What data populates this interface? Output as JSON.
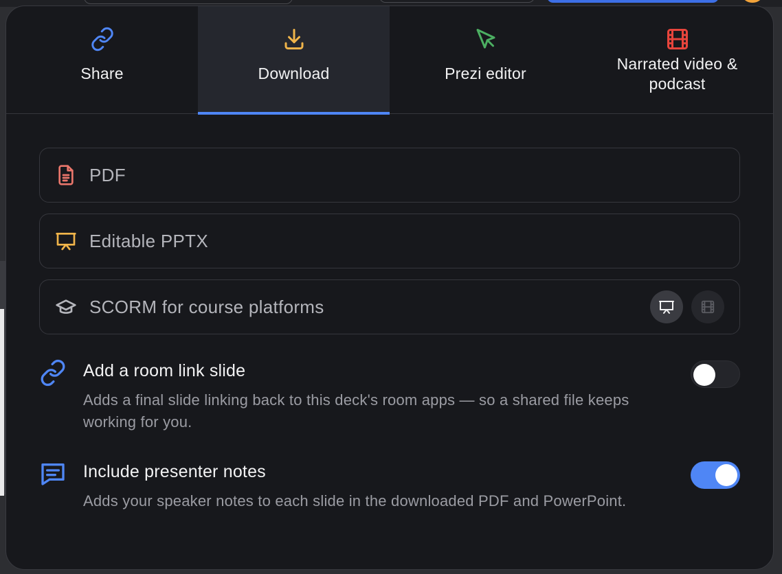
{
  "tabs": [
    {
      "label": "Share",
      "icon": "link-icon",
      "color": "#4f86f5",
      "active": false
    },
    {
      "label": "Download",
      "icon": "download-icon",
      "color": "#f0b44a",
      "active": true
    },
    {
      "label": "Prezi editor",
      "icon": "cursor-arrow-icon",
      "color": "#4caf62",
      "active": false
    },
    {
      "label": "Narrated video & podcast",
      "icon": "film-icon",
      "color": "#e8453c",
      "active": false
    }
  ],
  "download_options": [
    {
      "label": "PDF",
      "icon": "document-icon",
      "color": "#e9766b"
    },
    {
      "label": "Editable PPTX",
      "icon": "presentation-board-icon",
      "color": "#f0b44a"
    },
    {
      "label": "SCORM for course platforms",
      "icon": "graduation-cap-icon",
      "color": "#b4b5bb",
      "sub_options": [
        {
          "icon": "presentation-board-icon",
          "selected": true
        },
        {
          "icon": "film-icon",
          "selected": false
        }
      ]
    }
  ],
  "settings": [
    {
      "title": "Add a room link slide",
      "description": "Adds a final slide linking back to this deck's room apps — so a shared file keeps working for you.",
      "icon": "link-icon",
      "enabled": false
    },
    {
      "title": "Include presenter notes",
      "description": "Adds your speaker notes to each slide in the downloaded PDF and PowerPoint.",
      "icon": "speech-bubble-icon",
      "enabled": true
    }
  ],
  "colors": {
    "accent": "#4f86f5",
    "panel_bg": "#17181c",
    "active_tab_bg": "#25272e"
  }
}
